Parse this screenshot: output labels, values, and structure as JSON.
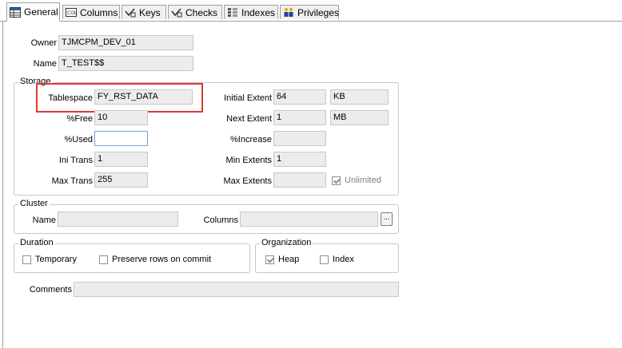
{
  "tabs": [
    {
      "label": "General",
      "icon": "table-icon"
    },
    {
      "label": "Columns",
      "icon": "columns-icon"
    },
    {
      "label": "Keys",
      "icon": "key-icon"
    },
    {
      "label": "Checks",
      "icon": "check-icon"
    },
    {
      "label": "Indexes",
      "icon": "index-icon"
    },
    {
      "label": "Privileges",
      "icon": "users-icon"
    }
  ],
  "general": {
    "owner_label": "Owner",
    "owner_value": "TJMCPM_DEV_01",
    "name_label": "Name",
    "name_value": "T_TEST$$"
  },
  "storage": {
    "title": "Storage",
    "tablespace_label": "Tablespace",
    "tablespace_value": "FY_RST_DATA",
    "pctfree_label": "%Free",
    "pctfree_value": "10",
    "pctused_label": "%Used",
    "pctused_value": "",
    "initrans_label": "Ini Trans",
    "initrans_value": "1",
    "maxtrans_label": "Max Trans",
    "maxtrans_value": "255",
    "initial_extent_label": "Initial Extent",
    "initial_extent_value": "64",
    "initial_extent_unit": "KB",
    "next_extent_label": "Next Extent",
    "next_extent_value": "1",
    "next_extent_unit": "MB",
    "pctincrease_label": "%Increase",
    "pctincrease_value": "",
    "min_extents_label": "Min Extents",
    "min_extents_value": "1",
    "max_extents_label": "Max Extents",
    "max_extents_value": "",
    "unlimited_label": "Unlimited"
  },
  "cluster": {
    "title": "Cluster",
    "name_label": "Name",
    "name_value": "",
    "columns_label": "Columns",
    "columns_value": "",
    "browse_label": "..."
  },
  "duration": {
    "title": "Duration",
    "temporary_label": "Temporary",
    "preserve_label": "Preserve rows on commit"
  },
  "organization": {
    "title": "Organization",
    "heap_label": "Heap",
    "index_label": "Index"
  },
  "comments": {
    "label": "Comments",
    "value": ""
  },
  "colors": {
    "highlight": "#e03535",
    "field_bg": "#ececec"
  }
}
